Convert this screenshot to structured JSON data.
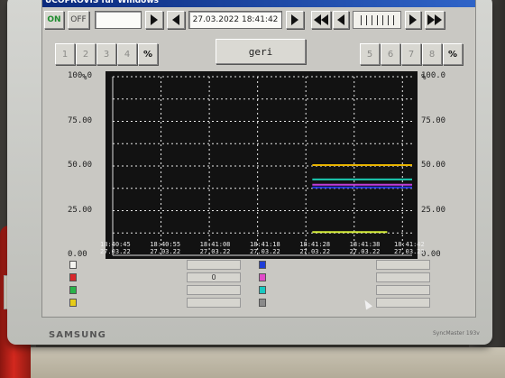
{
  "window": {
    "title": "UCOPROVIS für Windows"
  },
  "toolbar": {
    "on_label": "ON",
    "off_label": "OFF",
    "datetime": "27.03.2022  18:41:42"
  },
  "channels": {
    "left": [
      "1",
      "2",
      "3",
      "4",
      "%"
    ],
    "right": [
      "5",
      "6",
      "7",
      "8",
      "%"
    ],
    "back_label": "geri"
  },
  "monitor": {
    "brand": "SAMSUNG",
    "model": "SyncMaster 193v"
  },
  "chart_data": {
    "type": "line",
    "y_unit": "%",
    "ylim": [
      0,
      100
    ],
    "y_ticks_left": [
      "100.0",
      "75.00",
      "50.00",
      "25.00",
      "0.00"
    ],
    "y_ticks_right": [
      "100.0",
      "75.00",
      "50.00",
      "25.00",
      "0.00"
    ],
    "x_ticks": [
      {
        "time": "18:40:45",
        "date": "27.03.22"
      },
      {
        "time": "18:40:55",
        "date": "27.03.22"
      },
      {
        "time": "18:41:08",
        "date": "27.03.22"
      },
      {
        "time": "18:41:18",
        "date": "27.03.22"
      },
      {
        "time": "18:41:28",
        "date": "27.03.22"
      },
      {
        "time": "18:41:38",
        "date": "27.03.22"
      },
      {
        "time": "18:41:42",
        "date": "27.03.22"
      }
    ],
    "grid": true,
    "background": "#121212",
    "series": [
      {
        "color": "#e8b400",
        "x": [
          "18:41:28",
          "18:41:42"
        ],
        "values": [
          50.5,
          50.5
        ]
      },
      {
        "color": "#1cc9b0",
        "x": [
          "18:41:28",
          "18:41:42"
        ],
        "values": [
          42.5,
          42.5
        ]
      },
      {
        "color": "#c03cd8",
        "x": [
          "18:41:28",
          "18:41:42"
        ],
        "values": [
          39.5,
          39.5
        ]
      },
      {
        "color": "#2434e0",
        "x": [
          "18:41:28",
          "18:41:42"
        ],
        "values": [
          38.0,
          38.0
        ]
      },
      {
        "color": "#d6ee3a",
        "x": [
          "18:41:28",
          "18:41:40"
        ],
        "values": [
          13.0,
          13.0
        ]
      }
    ]
  },
  "legend": {
    "left": [
      {
        "color": "#f4f4f0",
        "value": ""
      },
      {
        "color": "#d8272b",
        "value": "0"
      },
      {
        "color": "#2ab34a",
        "value": ""
      },
      {
        "color": "#e6cc18",
        "value": ""
      }
    ],
    "right": [
      {
        "color": "#1e3ed8",
        "value": ""
      },
      {
        "color": "#e04ac8",
        "value": ""
      },
      {
        "color": "#18c8c0",
        "value": ""
      },
      {
        "color": "#8a8a8a",
        "value": ""
      }
    ]
  }
}
